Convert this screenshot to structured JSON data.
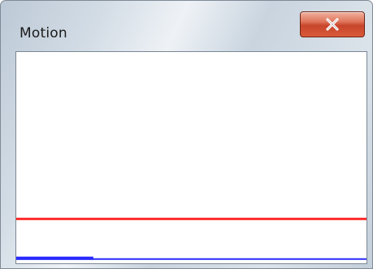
{
  "window": {
    "title": "Motion",
    "close_label": "x"
  },
  "plot": {
    "red_line": {
      "color": "#ff2a2a",
      "level": 0.21
    },
    "blue_line": {
      "color": "#2a2aff",
      "level": 0.02
    },
    "blue_thick_segment_fraction": 0.22
  },
  "colors": {
    "close_button": "#d2553a",
    "frame": "#c9d4df"
  }
}
